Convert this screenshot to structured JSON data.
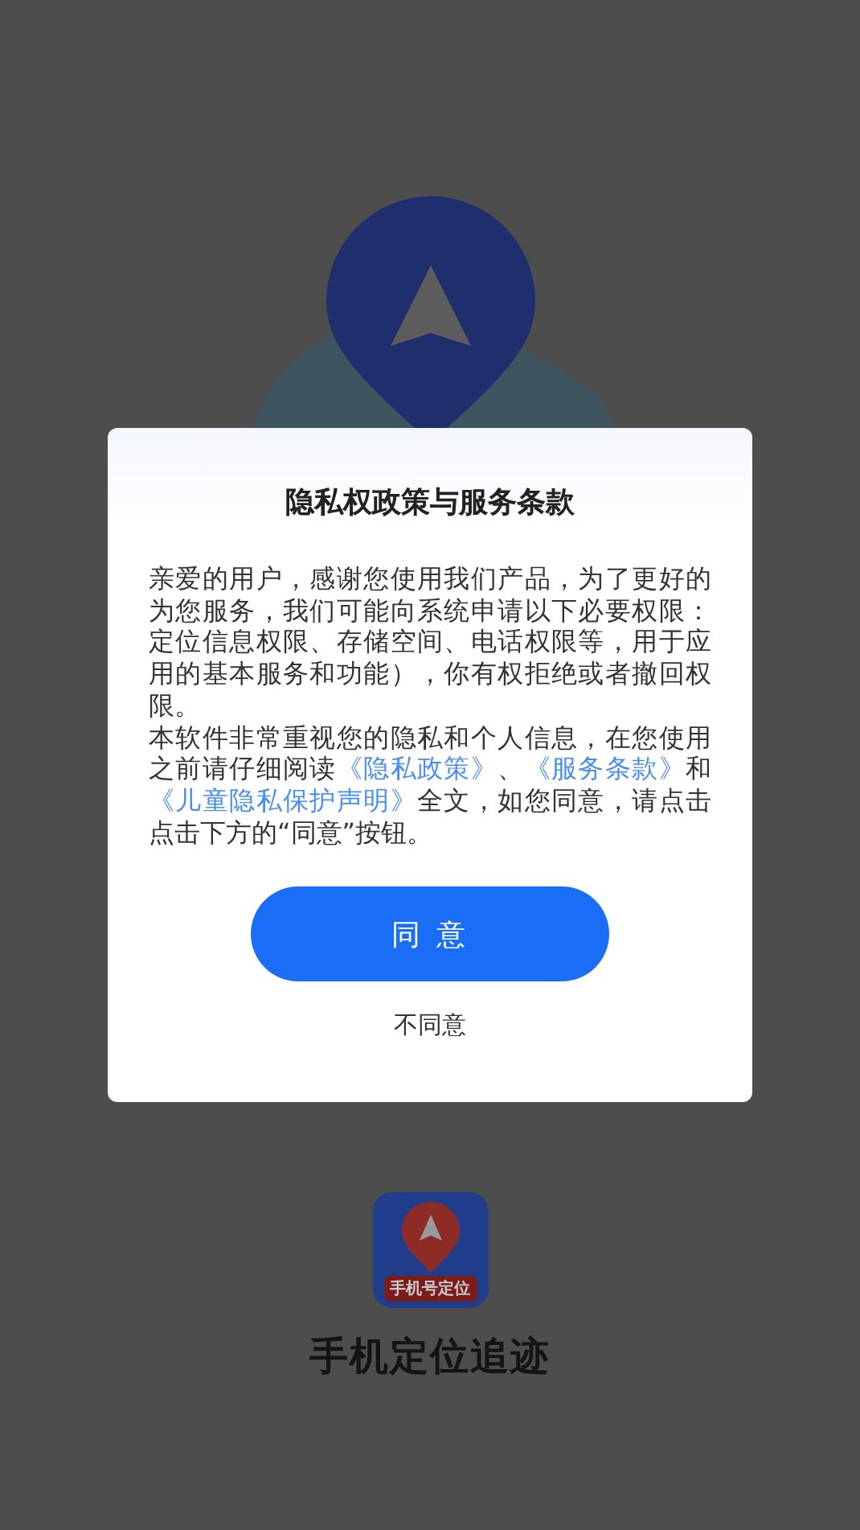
{
  "splash": {
    "icon_label": "手机号定位",
    "app_name": "手机定位追迹"
  },
  "dialog": {
    "title": "隐私权政策与服务条款",
    "paragraphs": [
      {
        "segments": [
          {
            "kind": "text",
            "text": "亲爱的用户，感谢您使用我们产品，为了更好的为您服务，我们可能向系统申请以下必要权限：定位信息权限、存储空间、电话权限等，用于应用的基本服务和功能），你有权拒绝或者撤回权限。"
          }
        ]
      },
      {
        "segments": [
          {
            "kind": "text",
            "text": "本软件非常重视您的隐私和个人信息，在您使用之前请仔细阅读"
          },
          {
            "kind": "link",
            "text": "《隐私政策》"
          },
          {
            "kind": "text",
            "text": "、"
          },
          {
            "kind": "link",
            "text": "《服务条款》"
          },
          {
            "kind": "text",
            "text": "和"
          },
          {
            "kind": "link",
            "text": "《儿童隐私保护声明》"
          },
          {
            "kind": "text",
            "text": "全文，如您同意，请点击点击下方的“同意”按钮。"
          }
        ]
      }
    ],
    "buttons": [
      {
        "kind": "primary",
        "label": "同 意"
      },
      {
        "kind": "plain",
        "label": "不同意"
      }
    ]
  }
}
